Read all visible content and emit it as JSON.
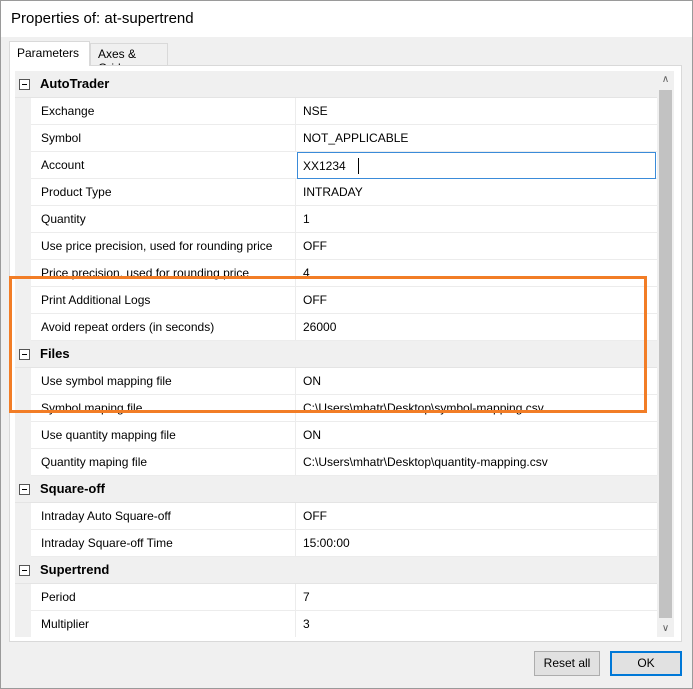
{
  "window": {
    "title": "Properties of: at-supertrend"
  },
  "tabs": [
    {
      "label": "Parameters",
      "active": true
    },
    {
      "label": "Axes & Grid",
      "active": false
    }
  ],
  "categories": {
    "autotrader": "AutoTrader",
    "files": "Files",
    "squareoff": "Square-off",
    "supertrend": "Supertrend"
  },
  "rows": {
    "exchange": {
      "name": "Exchange",
      "value": "NSE"
    },
    "symbol": {
      "name": "Symbol",
      "value": "NOT_APPLICABLE"
    },
    "account": {
      "name": "Account",
      "value": "XX1234"
    },
    "product_type": {
      "name": "Product Type",
      "value": "INTRADAY"
    },
    "quantity": {
      "name": "Quantity",
      "value": "1"
    },
    "use_price_precision": {
      "name": "Use price precision, used for rounding price",
      "value": "OFF"
    },
    "price_precision": {
      "name": "Price precision, used for rounding price",
      "value": "4"
    },
    "print_logs": {
      "name": "Print Additional Logs",
      "value": "OFF"
    },
    "avoid_repeat": {
      "name": "Avoid repeat orders (in seconds)",
      "value": "26000"
    },
    "use_symbol_mapping": {
      "name": "Use symbol mapping file",
      "value": "ON"
    },
    "symbol_mapping_file": {
      "name": "Symbol maping file",
      "value": "C:\\Users\\mhatr\\Desktop\\symbol-mapping.csv"
    },
    "use_quantity_mapping": {
      "name": "Use quantity mapping file",
      "value": "ON"
    },
    "quantity_mapping_file": {
      "name": "Quantity maping file",
      "value": "C:\\Users\\mhatr\\Desktop\\quantity-mapping.csv"
    },
    "intraday_auto_squareoff": {
      "name": "Intraday Auto Square-off",
      "value": "OFF"
    },
    "intraday_squareoff_time": {
      "name": "Intraday Square-off Time",
      "value": "15:00:00"
    },
    "period": {
      "name": "Period",
      "value": "7"
    },
    "multiplier": {
      "name": "Multiplier",
      "value": "3"
    }
  },
  "scrollbar": {
    "up_icon": "∧",
    "down_icon": "∨"
  },
  "buttons": {
    "reset": "Reset all",
    "ok": "OK"
  },
  "colors": {
    "highlight": "#f27d26",
    "focus": "#3a8bd9",
    "ok_border": "#0078d7"
  }
}
